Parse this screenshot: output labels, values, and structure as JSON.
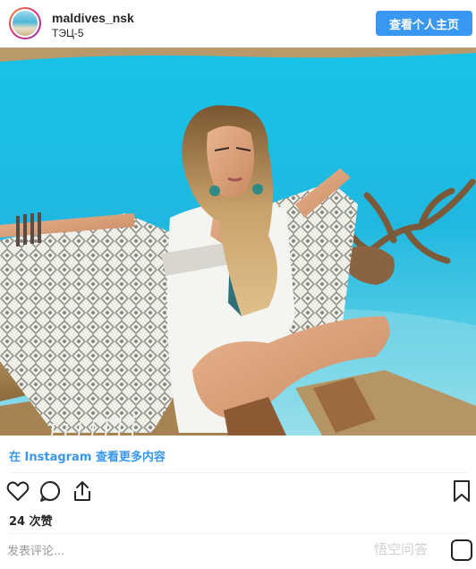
{
  "header": {
    "username": "maldives_nsk",
    "location": "ТЭЦ-5",
    "profile_button": "查看个人主页"
  },
  "photo": {
    "description_alt": "woman in white kaftan sitting by turquoise water"
  },
  "view_more_link": "在 Instagram 查看更多内容",
  "actions": {
    "like_icon": "heart-icon",
    "comment_icon": "comment-icon",
    "share_icon": "share-icon",
    "save_icon": "bookmark-icon"
  },
  "likes_text": "24 次赞",
  "comment": {
    "placeholder": "发表评论..."
  },
  "watermark": {
    "text": "悟空问答"
  },
  "colors": {
    "accent": "#3897f0",
    "text": "#262626",
    "divider": "#efefef"
  }
}
